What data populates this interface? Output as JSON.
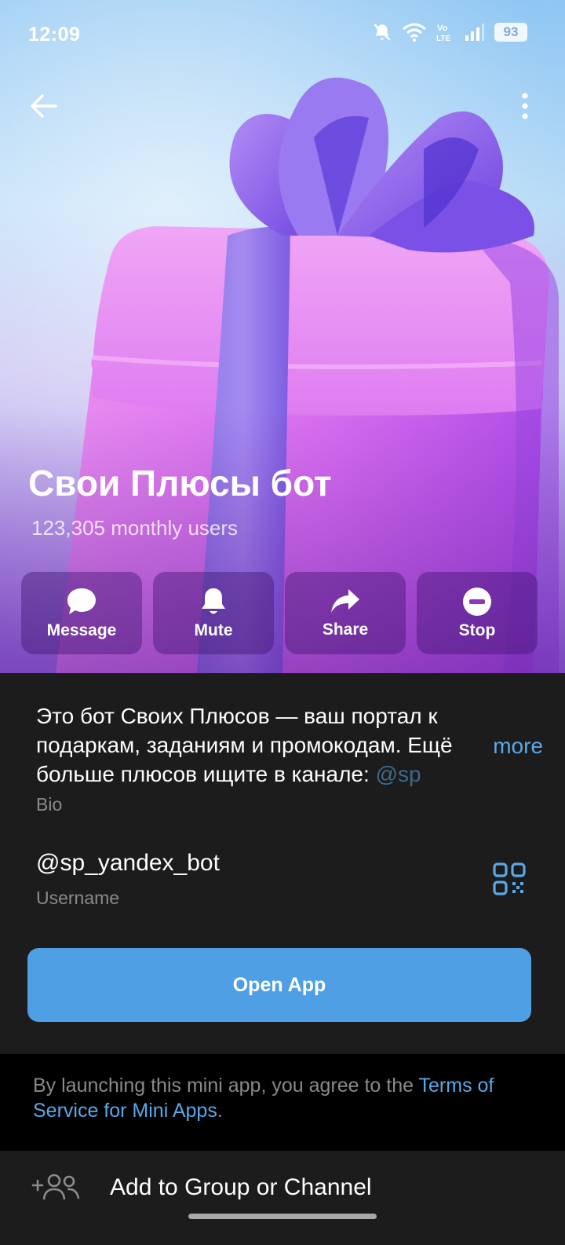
{
  "status_bar": {
    "time": "12:09",
    "volte": "Vo LTE",
    "battery": "93"
  },
  "header": {
    "back_icon": "arrow-left-icon",
    "menu_icon": "more-vertical-icon"
  },
  "profile": {
    "title": "Свои Плюсы бот",
    "subtitle": "123,305 monthly users"
  },
  "actions": [
    {
      "label": "Message",
      "icon": "message-bubble-icon"
    },
    {
      "label": "Mute",
      "icon": "bell-icon"
    },
    {
      "label": "Share",
      "icon": "share-arrow-icon"
    },
    {
      "label": "Stop",
      "icon": "stop-icon"
    }
  ],
  "bio": {
    "line1": "Это бот Своих Плюсов — ваш портал к",
    "line2": "подаркам, заданиям и промокодам. Ещё",
    "line3": "больше плюсов ищите в канале: ",
    "line3_link": "@sp",
    "more": "more",
    "label": "Bio"
  },
  "username": {
    "value": "@sp_yandex_bot",
    "label": "Username",
    "qr_icon": "qr-code-icon"
  },
  "open_app": {
    "label": "Open App"
  },
  "terms": {
    "text": "By launching this mini app, you agree to the ",
    "link": "Terms of Service for Mini Apps",
    "end": "."
  },
  "add_group": {
    "label": "Add to Group or Channel",
    "icon": "add-users-icon"
  },
  "colors": {
    "accent": "#4e9fe3",
    "link": "#5aa8e6",
    "card_bg": "#1c1c1d",
    "secondary_text": "#8a8a8e"
  }
}
